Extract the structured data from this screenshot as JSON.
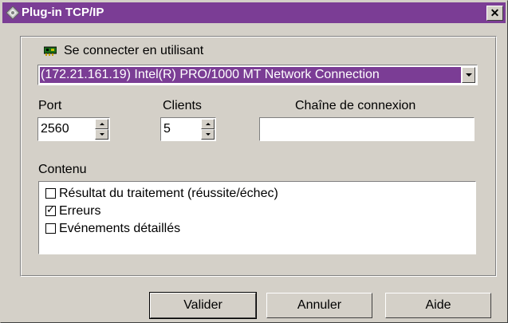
{
  "window": {
    "title": "Plug-in TCP/IP",
    "close_glyph": "✕",
    "icon": "plugin-icon"
  },
  "connection": {
    "label": "Se connecter en utilisant",
    "icon": "network-adapter-icon",
    "selected": "(172.21.161.19) Intel(R) PRO/1000 MT Network Connection"
  },
  "port": {
    "label": "Port",
    "value": "2560"
  },
  "clients": {
    "label": "Clients",
    "value": "5"
  },
  "connection_string": {
    "label": "Chaîne de connexion",
    "value": ""
  },
  "content": {
    "label": "Contenu",
    "items": [
      {
        "label": "Résultat du traitement (réussite/échec)",
        "checked": false,
        "mark": ""
      },
      {
        "label": "Erreurs",
        "checked": true,
        "mark": "✓"
      },
      {
        "label": "Evénements détaillés",
        "checked": false,
        "mark": ""
      }
    ]
  },
  "buttons": {
    "validate": "Valider",
    "cancel": "Annuler",
    "help": "Aide"
  },
  "colors": {
    "titlebar": "#7b3d95",
    "selection": "#7b3d95",
    "face": "#d4d0c8"
  }
}
